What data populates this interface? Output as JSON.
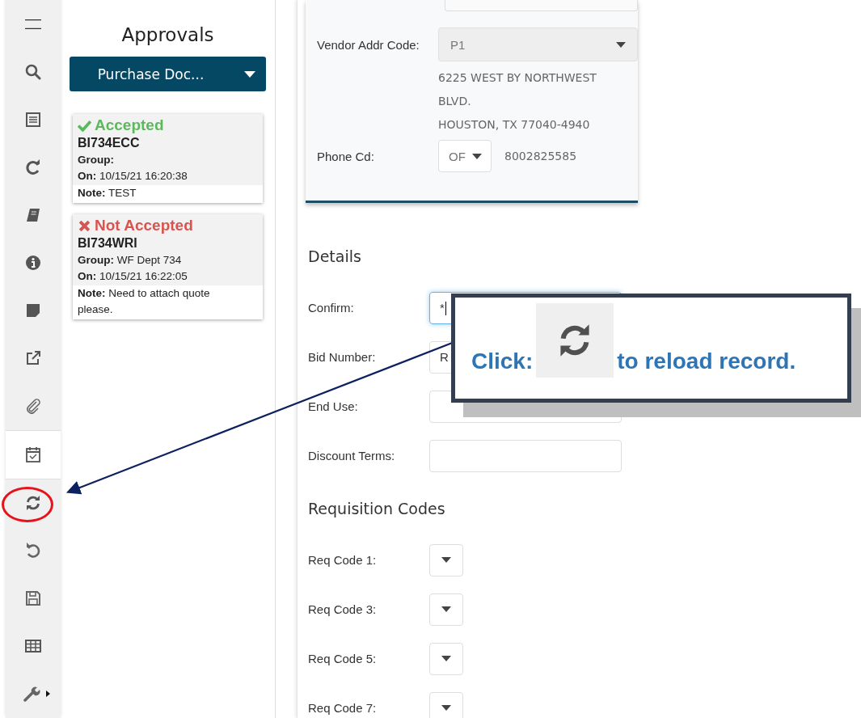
{
  "sidebar": {
    "items": [
      {
        "selected": false,
        "circled": false
      },
      {
        "selected": false,
        "circled": false
      },
      {
        "selected": false,
        "circled": false
      },
      {
        "selected": false,
        "circled": false
      },
      {
        "selected": false,
        "circled": false
      },
      {
        "selected": false,
        "circled": false
      },
      {
        "selected": false,
        "circled": false
      },
      {
        "selected": false,
        "circled": false
      },
      {
        "selected": false,
        "circled": false
      },
      {
        "selected": true,
        "circled": false
      },
      {
        "selected": false,
        "circled": true
      },
      {
        "selected": false,
        "circled": false
      },
      {
        "selected": false,
        "circled": false
      },
      {
        "selected": false,
        "circled": false
      },
      {
        "selected": false,
        "circled": false
      }
    ]
  },
  "approvals": {
    "title": "Approvals",
    "dropdown": "Purchase Doc...",
    "cards": [
      {
        "kind": "accepted",
        "status_text": "Accepted",
        "code": "BI734ECC",
        "group": "**Group:**",
        "on": "**On:** 10/15/21 16:20:38",
        "note": "**Note:** TEST"
      },
      {
        "kind": "rejected",
        "status_text": "Not Accepted",
        "code": "BI734WRI",
        "group": "**Group:** WF Dept 734",
        "on": "**On:** 10/15/21 16:22:05",
        "note": "**Note:** Need to attach quote please."
      }
    ]
  },
  "vendor": {
    "addr_code_label": "Vendor Addr Code:",
    "addr_code_value": "P1",
    "address_lines": [
      "6225 WEST BY NORTHWEST",
      "BLVD.",
      "HOUSTON, TX 77040-4940"
    ],
    "phone_label": "Phone Cd:",
    "phone_code": "OF",
    "phone_number": "8002825585"
  },
  "details": {
    "title": "Details",
    "fields": [
      {
        "label": "Confirm:",
        "value": "*",
        "focused": true
      },
      {
        "label": "Bid Number:",
        "value": "R",
        "focused": false
      },
      {
        "label": "End Use:",
        "focused": false
      },
      {
        "label": "Discount Terms:",
        "focused": false
      }
    ]
  },
  "requisition": {
    "title": "Requisition Codes",
    "fields": [
      {
        "label": "Req Code 1:"
      },
      {
        "label": "Req Code 3:"
      },
      {
        "label": "Req Code 5:"
      },
      {
        "label": "Req Code 7:"
      }
    ]
  },
  "callout": {
    "text_before": "Click:",
    "text_after": "to reload record."
  }
}
